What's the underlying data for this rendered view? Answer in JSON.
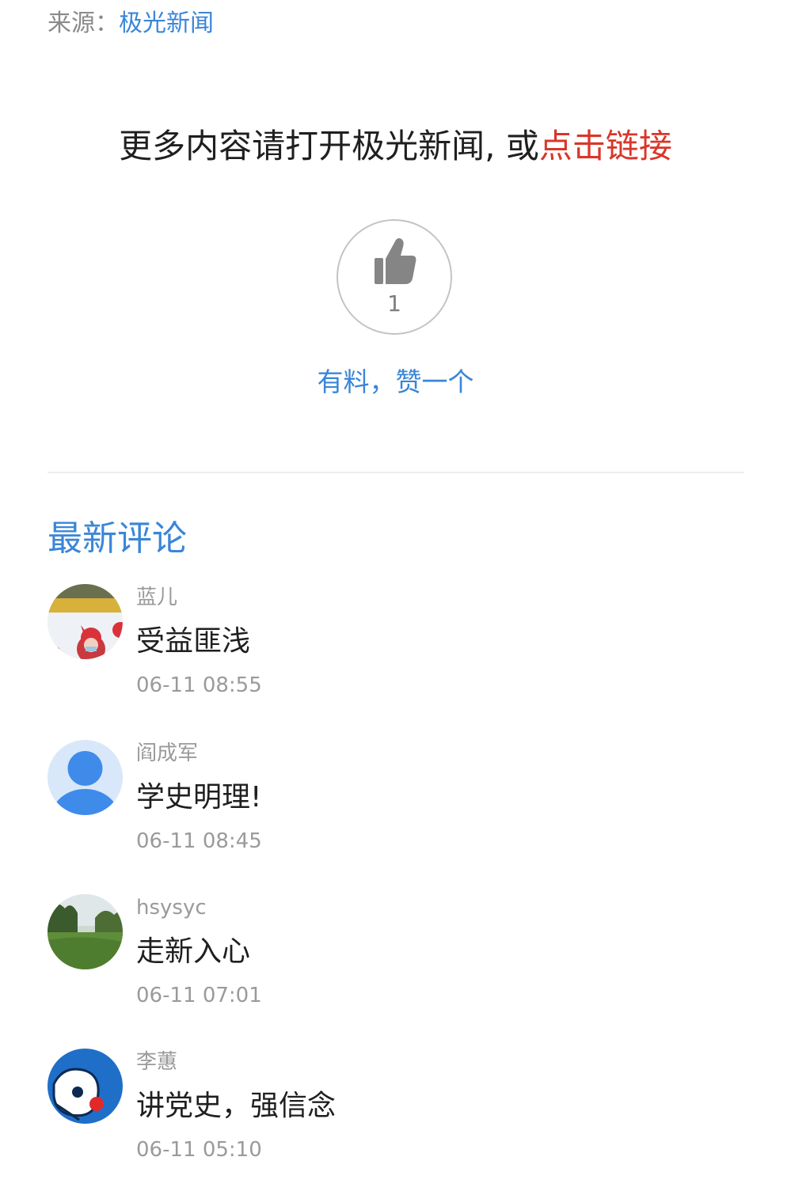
{
  "source": {
    "prefix": "来源：",
    "name": "极光新闻"
  },
  "promo": {
    "text": "更多内容请打开极光新闻, 或",
    "link": "点击链接"
  },
  "like": {
    "count": "1",
    "cta": "有料，赞一个",
    "icon": "thumbs-up-icon"
  },
  "comments_section": {
    "title": "最新评论",
    "items": [
      {
        "author": "蓝儿",
        "content": "受益匪浅",
        "time": "06-11 08:55"
      },
      {
        "author": "阎成军",
        "content": "学史明理!",
        "time": "06-11 08:45"
      },
      {
        "author": "hsysyc",
        "content": "走新入心",
        "time": "06-11 07:01"
      },
      {
        "author": "李蕙",
        "content": "讲党史，强信念",
        "time": "06-11 05:10"
      }
    ]
  },
  "colors": {
    "accent": "#3a86d8",
    "link_red": "#d8372a",
    "muted": "#9a9a9a",
    "text": "#1f1f1f"
  }
}
